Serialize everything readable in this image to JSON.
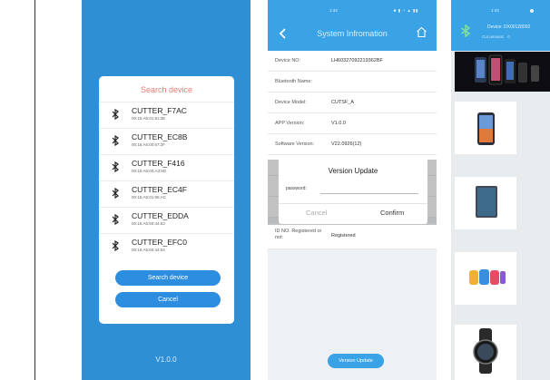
{
  "panel1": {
    "modal_title": "Search device",
    "devices": [
      {
        "name": "CUTTER_F7AC",
        "addr": "00:15:A6:01:91:3E"
      },
      {
        "name": "CUTTER_EC8B",
        "addr": "00:16:A6:00:67:2F"
      },
      {
        "name": "CUTTER_F416",
        "addr": "00:15:A6:00:A3:8D"
      },
      {
        "name": "CUTTER_EC4F",
        "addr": "00:15:A5:01:95:AC"
      },
      {
        "name": "CUTTER_EDDA",
        "addr": "00:16:A5:60:44:53"
      },
      {
        "name": "CUTTER_EFC0",
        "addr": "00:16:A5:60:44:54"
      }
    ],
    "search_button": "Search device",
    "cancel_button": "Cancel",
    "version": "V1.0.0"
  },
  "panel2": {
    "time": "1:44",
    "title": "System Infromation",
    "rows": [
      {
        "label": "Device NO:",
        "value": "LH60327092219362BF"
      },
      {
        "label": "Bluetooth Name:",
        "value": ""
      },
      {
        "label": "Device Model:",
        "value": "CUTSF_A"
      },
      {
        "label": "APP Version:",
        "value": "V1.0.0"
      },
      {
        "label": "Software Version:",
        "value": "V22.0926(12)"
      }
    ],
    "idno_label": "ID NO. Registered or not:",
    "idno_value": "Registered",
    "dialog": {
      "title": "Version Update",
      "password_label": "password:",
      "cancel": "Cancel",
      "confirm": "Confirm"
    },
    "update_button": "Version Update"
  },
  "panel3": {
    "time": "1:43",
    "device_text": "Device: DX00128092",
    "cut_amount_label": "Cut amount:",
    "cut_amount_value": "0"
  },
  "colors": {
    "panel_blue": "#2f8fd4",
    "header_blue": "#3aa3e6",
    "button_blue": "#2d8ee0",
    "accent_red": "#e97b74"
  }
}
